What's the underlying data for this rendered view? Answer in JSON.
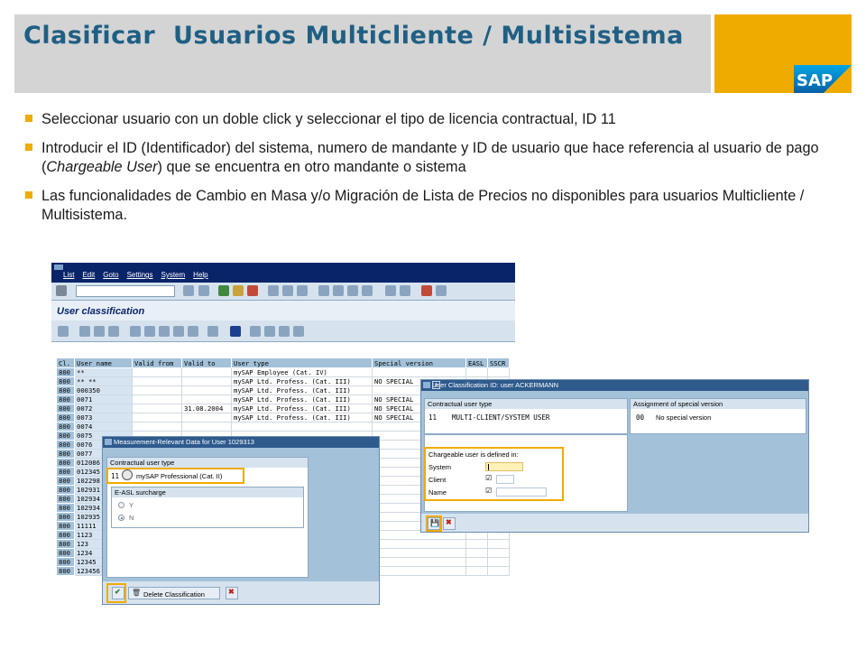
{
  "slide": {
    "title": "Clasificar  Usuarios Multicliente / Multisistema",
    "logo_text": "SAP",
    "colors": {
      "title": "#1f5f84",
      "brand_gold": "#f0ab00",
      "sap_blue": "#0a246a",
      "window_bg": "#a3c1d9"
    }
  },
  "bullets": [
    {
      "text": "Seleccionar usuario  con un doble click y seleccionar el tipo de licencia contractual, ID 11"
    },
    {
      "before": "Introducir el ID (Identificador) del sistema, numero de mandante y ID de usuario que hace referencia al usuario de pago (",
      "em": "Chargeable User",
      "after": ") que se encuentra en otro mandante o sistema"
    },
    {
      "text": "Las funcionalidades de Cambio en Masa y/o Migración de Lista de Precios no disponibles para usuarios Multicliente / Multisistema."
    }
  ],
  "sap_window": {
    "menu": [
      "List",
      "Edit",
      "Goto",
      "Settings",
      "System",
      "Help"
    ],
    "title": "User classification",
    "toolbar_icons": [
      "check-icon",
      "save-icon",
      "back-icon",
      "exit-icon",
      "cancel-icon",
      "print-icon",
      "find-icon",
      "page-icon",
      "layout-icon",
      "help-icon"
    ],
    "grid": {
      "columns": [
        "Cl.",
        "User name",
        "Valid from",
        "Valid to",
        "User type",
        "Special version",
        "EASL",
        "SSCR"
      ],
      "rows": [
        [
          "800",
          "**",
          "",
          "",
          "mySAP Employee (Cat. IV)",
          "",
          "",
          ""
        ],
        [
          "800",
          "** **",
          "",
          "",
          "mySAP Ltd. Profess. (Cat. III)",
          "NO SPECIAL",
          "",
          ""
        ],
        [
          "800",
          "000350",
          "",
          "",
          "mySAP Ltd. Profess. (Cat. III)",
          "",
          "",
          ""
        ],
        [
          "800",
          "0071",
          "",
          "",
          "mySAP Ltd. Profess. (Cat. III)",
          "NO SPECIAL",
          "",
          ""
        ],
        [
          "800",
          "0072",
          "",
          "31.08.2004",
          "mySAP Ltd. Profess. (Cat. III)",
          "NO SPECIAL",
          "",
          ""
        ],
        [
          "800",
          "0073",
          "",
          "",
          "mySAP Ltd. Profess. (Cat. III)",
          "NO SPECIAL",
          "",
          ""
        ],
        [
          "800",
          "0074",
          "",
          "",
          "",
          "",
          "",
          ""
        ],
        [
          "800",
          "0075",
          "",
          "",
          "",
          "",
          "",
          ""
        ],
        [
          "800",
          "0076",
          "",
          "",
          "",
          "",
          "",
          ""
        ],
        [
          "800",
          "0077",
          "",
          "",
          "",
          "",
          "",
          ""
        ],
        [
          "800",
          "012086",
          "",
          "",
          "",
          "",
          "",
          ""
        ],
        [
          "800",
          "012345",
          "",
          "",
          "",
          "",
          "",
          ""
        ],
        [
          "800",
          "102298",
          "",
          "",
          "",
          "",
          "",
          ""
        ],
        [
          "800",
          "102931",
          "",
          "",
          "",
          "",
          "",
          ""
        ],
        [
          "800",
          "102934",
          "",
          "",
          "",
          "",
          "",
          ""
        ],
        [
          "800",
          "102934",
          "",
          "",
          "",
          "",
          "",
          ""
        ],
        [
          "800",
          "102935",
          "",
          "",
          "",
          "",
          "",
          ""
        ],
        [
          "800",
          "11111",
          "",
          "",
          "",
          "",
          "",
          ""
        ],
        [
          "800",
          "1123",
          "",
          "",
          "",
          "",
          "",
          ""
        ],
        [
          "800",
          "123",
          "",
          "",
          "",
          "",
          "",
          ""
        ],
        [
          "800",
          "1234",
          "",
          "",
          "",
          "",
          "",
          ""
        ],
        [
          "800",
          "12345",
          "",
          "",
          "",
          "",
          "",
          ""
        ],
        [
          "800",
          "123456",
          "",
          "",
          "",
          "",
          "",
          ""
        ]
      ]
    }
  },
  "measurement_dialog": {
    "title": "Measurement-Relevant Data for User 1029313",
    "contractual_box_title": "Contractual user type",
    "contractual_id": "11",
    "contractual_value": "mySAP Professional (Cat. II)",
    "easl_box_title": "E-ASL surcharge",
    "radio_options": [
      {
        "label": "Y",
        "selected": false
      },
      {
        "label": "N",
        "selected": true
      }
    ],
    "delete_button": "Delete Classification"
  },
  "classification_dialog": {
    "title": "User Classification ID: user ACKERMANN",
    "contractual_box_title": "Contractual user type",
    "contractual_id": "11",
    "contractual_value": "MULTI-CLIENT/SYSTEM USER",
    "special_box_title": "Assignment of special version",
    "special_id": "00",
    "special_value": "No special version",
    "chargeable_title": "Chargeable user is defined in:",
    "fields": [
      {
        "label": "System",
        "value": ""
      },
      {
        "label": "Client",
        "value": ""
      },
      {
        "label": "Name",
        "value": ""
      }
    ]
  }
}
